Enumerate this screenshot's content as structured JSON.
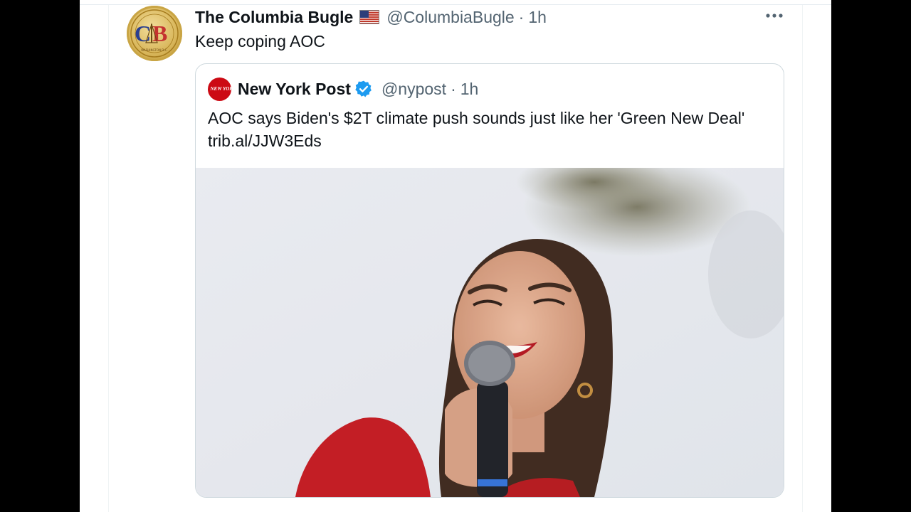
{
  "tweet": {
    "author_name": "The Columbia Bugle",
    "author_handle": "@ColumbiaBugle",
    "separator": "·",
    "time": "1h",
    "text": "Keep coping AOC",
    "avatar_letters": "CB"
  },
  "quoted_tweet": {
    "author_name": "New York Post",
    "author_handle": "@nypost",
    "separator": "·",
    "time": "1h",
    "logo_text": "NEW YORK POST",
    "text_line1": "AOC says Biden's $2T climate push sounds just like her 'Green New Deal'",
    "text_line2": "trib.al/JJW3Eds"
  },
  "icons": {
    "more": "more-options-icon",
    "flag": "us-flag-icon",
    "verified": "verified-badge-icon"
  },
  "colors": {
    "text_primary": "#0f1419",
    "text_secondary": "#536471",
    "verified_blue": "#1d9bf0",
    "nypost_red": "#cc0a14",
    "border": "#cfd9de"
  }
}
